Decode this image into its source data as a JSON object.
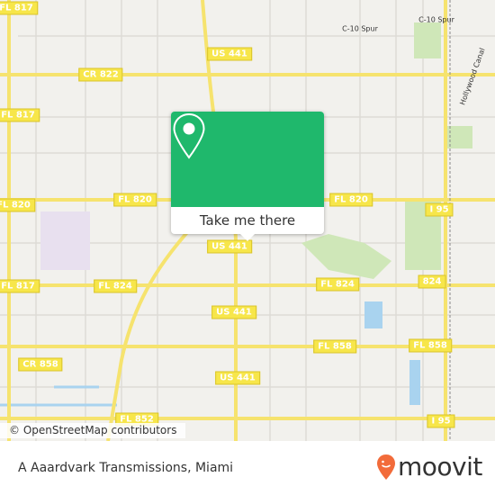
{
  "map": {
    "road_labels": [
      "FL 817",
      "US 441",
      "CR 822",
      "C-10 Spur",
      "C-10 Spur",
      "FL 817",
      "FL 820",
      "FL 820",
      "FL 820",
      "I 95",
      "US 441",
      "FL 817",
      "FL 824",
      "FL 824",
      "824",
      "US 441",
      "FL 858",
      "FL 858",
      "CR 858",
      "US 441",
      "FL 852",
      "I 95"
    ],
    "water_labels": [
      "Hollywood Canal"
    ],
    "attribution": "© OpenStreetMap contributors"
  },
  "popup": {
    "cta_label": "Take me there",
    "color": "#1fb86c"
  },
  "footer": {
    "place_name": "A Aaardvark Transmissions, Miami",
    "brand": "moovit",
    "brand_color": "#f26b3a"
  }
}
